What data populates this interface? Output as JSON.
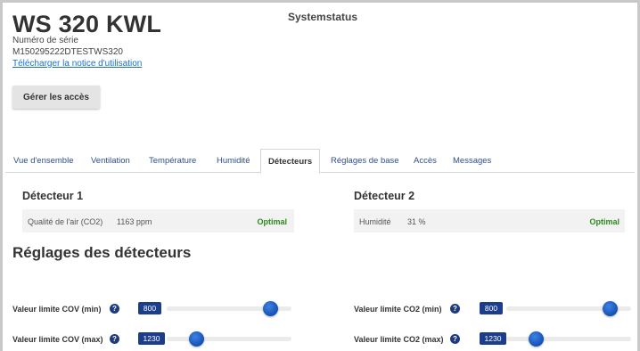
{
  "header": {
    "device_name": "WS 320 KWL",
    "serial_label": "Numéro de série",
    "serial_value": "M150295222DTESTWS320",
    "manual_link": "Télécharger la notice d'utilisation",
    "system_status": "Systemstatus",
    "access_button": "Gérer les accès"
  },
  "tabs": [
    {
      "label": "Vue d'ensemble",
      "active": false
    },
    {
      "label": "Ventilation",
      "active": false
    },
    {
      "label": "Température",
      "active": false
    },
    {
      "label": "Humidité",
      "active": false
    },
    {
      "label": "Détecteurs",
      "active": true
    },
    {
      "label": "Réglages de base",
      "active": false
    },
    {
      "label": "Accès",
      "active": false
    },
    {
      "label": "Messages",
      "active": false
    }
  ],
  "detectors": [
    {
      "title": "Détecteur 1",
      "measure_label": "Qualité de l'air (CO2)",
      "measure_value": "1163 ppm",
      "status": "Optimal"
    },
    {
      "title": "Détecteur 2",
      "measure_label": "Humidité",
      "measure_value": "31 %",
      "status": "Optimal"
    }
  ],
  "settings": {
    "title": "Réglages des détecteurs",
    "limits": [
      {
        "label": "Valeur limite COV (min)",
        "value": "800",
        "slider_fraction": 0.88
      },
      {
        "label": "Valeur limite COV (max)",
        "value": "1230",
        "slider_fraction": 0.2
      },
      {
        "label": "Valeur limite CO2 (min)",
        "value": "800",
        "slider_fraction": 0.88
      },
      {
        "label": "Valeur limite CO2 (max)",
        "value": "1230",
        "slider_fraction": 0.2
      }
    ]
  },
  "colors": {
    "accent": "#1c3c8c",
    "status_ok": "#2b8a1e",
    "link": "#1a6fc9"
  },
  "icons": {
    "help": "question-circle-icon"
  }
}
